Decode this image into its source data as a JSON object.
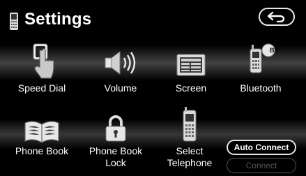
{
  "header": {
    "title": "Settings",
    "icon": "phone-icon",
    "back_icon": "back-arrow-icon"
  },
  "menu": {
    "speed_dial": {
      "label": "Speed Dial",
      "icon": "hand-touch-icon"
    },
    "volume": {
      "label": "Volume",
      "icon": "speaker-icon"
    },
    "screen": {
      "label": "Screen",
      "icon": "display-icon"
    },
    "bluetooth": {
      "label": "Bluetooth",
      "icon": "bluetooth-phone-icon",
      "badge": "BT"
    },
    "phone_book": {
      "label": "Phone Book",
      "icon": "book-icon"
    },
    "phone_book_lock": {
      "label_line1": "Phone Book",
      "label_line2": "Lock",
      "icon": "padlock-icon"
    },
    "select_telephone": {
      "label_line1": "Select",
      "label_line2": "Telephone",
      "icon": "mobile-phone-icon"
    }
  },
  "buttons": {
    "auto_connect": {
      "label": "Auto Connect",
      "enabled": true
    },
    "connect": {
      "label": "Connect",
      "enabled": false
    }
  },
  "colors": {
    "background": "#000000",
    "text": "#ffffff",
    "disabled": "#555555"
  }
}
